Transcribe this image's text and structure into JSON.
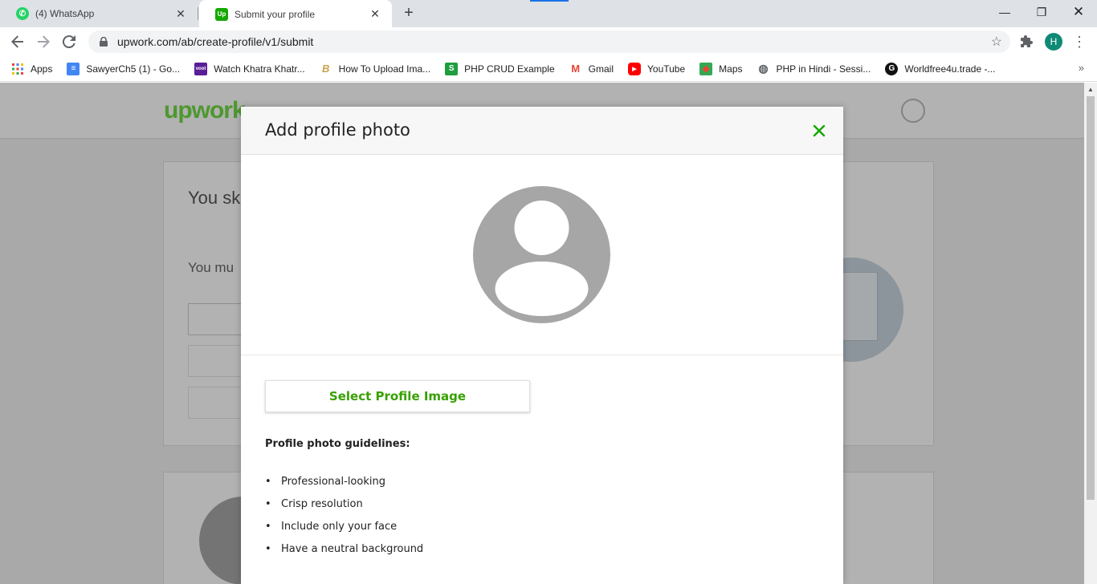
{
  "browser": {
    "tabs": [
      {
        "title": "(4) WhatsApp",
        "active": false
      },
      {
        "title": "Submit your profile",
        "active": true
      }
    ],
    "url": "upwork.com/ab/create-profile/v1/submit",
    "profile_initial": "H",
    "bookmarks": [
      {
        "label": "Apps",
        "icon": "apps-grid-icon"
      },
      {
        "label": "SawyerCh5 (1) - Go...",
        "icon": "google-docs-icon"
      },
      {
        "label": "Watch Khatra Khatr...",
        "icon": "voot-icon"
      },
      {
        "label": "How To Upload Ima...",
        "icon": "b-logo-icon"
      },
      {
        "label": "PHP CRUD Example",
        "icon": "s-logo-icon"
      },
      {
        "label": "Gmail",
        "icon": "gmail-icon"
      },
      {
        "label": "YouTube",
        "icon": "youtube-icon"
      },
      {
        "label": "Maps",
        "icon": "maps-icon"
      },
      {
        "label": "PHP in Hindi - Sessi...",
        "icon": "globe-icon"
      },
      {
        "label": "Worldfree4u.trade -...",
        "icon": "g-logo-icon"
      }
    ]
  },
  "background_page": {
    "logo": "upwork",
    "heading": "You sk",
    "subtext": "You mu"
  },
  "modal": {
    "title": "Add profile photo",
    "select_button": "Select Profile Image",
    "guidelines_title": "Profile photo guidelines:",
    "guidelines": [
      "Professional-looking",
      "Crisp resolution",
      "Include only your face",
      "Have a neutral background"
    ]
  },
  "colors": {
    "accent_green": "#37a000",
    "close_green": "#14a800",
    "avatar_gray": "#a6a6a6"
  }
}
